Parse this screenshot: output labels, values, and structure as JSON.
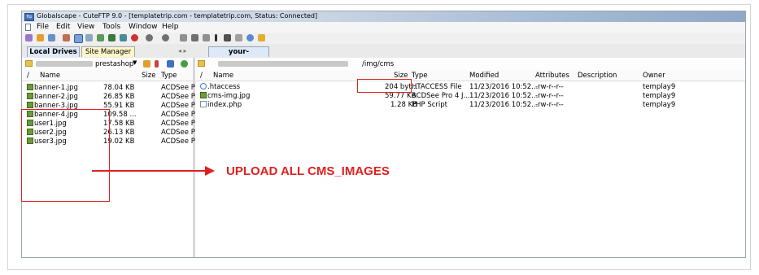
{
  "window": {
    "title": "Globalscape - CuteFTP 9.0 - [templatetrip.com - templatetrip.com, Status: Connected]",
    "app_icon_text": "ftp"
  },
  "menu": [
    "File",
    "Edit",
    "View",
    "Tools",
    "Window",
    "Help"
  ],
  "tabs": {
    "left": [
      {
        "label": "Local Drives",
        "active": true
      },
      {
        "label": "Site Manager",
        "active": false
      }
    ],
    "right": [
      {
        "label": "your-store.com",
        "active": true
      }
    ]
  },
  "left_pane": {
    "path_suffix": "prestashop",
    "columns": [
      "/",
      "Name",
      "Size",
      "Type"
    ],
    "files": [
      {
        "name": "banner-1.jpg",
        "size": "78.04 KB",
        "type": "ACDSee Pr"
      },
      {
        "name": "banner-2.jpg",
        "size": "26.85 KB",
        "type": "ACDSee Pr"
      },
      {
        "name": "banner-3.jpg",
        "size": "55.91 KB",
        "type": "ACDSee Pr"
      },
      {
        "name": "banner-4.jpg",
        "size": "109.58 ...",
        "type": "ACDSee Pr"
      },
      {
        "name": "user1.jpg",
        "size": "17.58 KB",
        "type": "ACDSee Pr"
      },
      {
        "name": "user2.jpg",
        "size": "26.13 KB",
        "type": "ACDSee Pr"
      },
      {
        "name": "user3.jpg",
        "size": "19.02 KB",
        "type": "ACDSee Pr"
      }
    ]
  },
  "right_pane": {
    "path": "/img/cms",
    "columns": [
      "/",
      "Name",
      "Size",
      "Type",
      "Modified",
      "Attributes",
      "Description",
      "Owner"
    ],
    "files": [
      {
        "name": ".htaccess",
        "size": "204 byt...",
        "type": "HTACCESS File",
        "modified": "11/23/2016 10:52...",
        "attributes": "-rw-r--r--",
        "owner": "templay9",
        "kind": "ht"
      },
      {
        "name": "cms-img.jpg",
        "size": "59.77 KB",
        "type": "ACDSee Pro 4 J...",
        "modified": "11/23/2016 10:52...",
        "attributes": "-rw-r--r--",
        "owner": "templay9",
        "kind": "jpg"
      },
      {
        "name": "index.php",
        "size": "1.28 KB",
        "type": "PHP Script",
        "modified": "11/23/2016 10:52...",
        "attributes": "-rw-r--r--",
        "owner": "templay9",
        "kind": "php"
      }
    ]
  },
  "annotation": {
    "label": "UPLOAD ALL CMS_IMAGES",
    "color": "#e02020"
  }
}
